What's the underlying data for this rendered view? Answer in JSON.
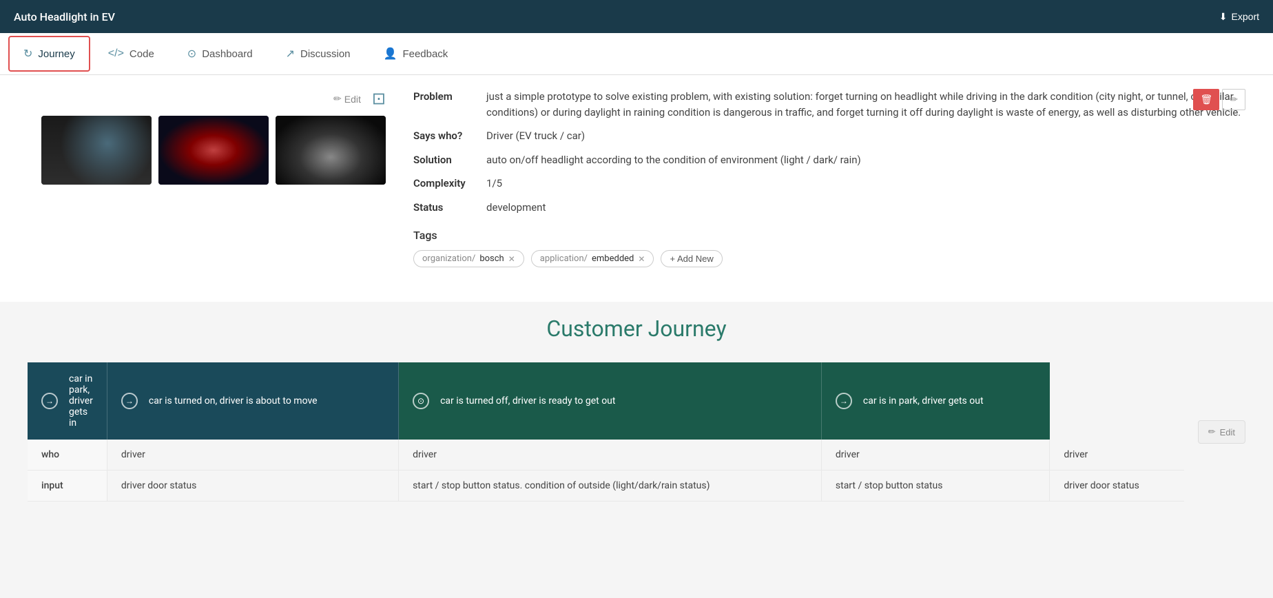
{
  "app": {
    "title": "Auto Headlight in EV",
    "export_label": "Export"
  },
  "nav": {
    "tabs": [
      {
        "id": "journey",
        "label": "Journey",
        "icon": "↻",
        "active": true
      },
      {
        "id": "code",
        "label": "Code",
        "icon": "</>",
        "active": false
      },
      {
        "id": "dashboard",
        "label": "Dashboard",
        "icon": "⊙",
        "active": false
      },
      {
        "id": "discussion",
        "label": "Discussion",
        "icon": "↗",
        "active": false
      },
      {
        "id": "feedback",
        "label": "Feedback",
        "icon": "👤",
        "active": false
      }
    ]
  },
  "details": {
    "edit_label": "Edit",
    "problem_label": "Problem",
    "problem_value": "just a simple prototype to solve existing problem, with existing solution: forget turning on headlight while driving in the dark condition (city night, or tunnel, or similar conditions) or during daylight in raining condition is dangerous in traffic, and forget turning it off during daylight is waste of energy, as well as disturbing other vehicle.",
    "says_who_label": "Says who?",
    "says_who_value": "Driver (EV truck / car)",
    "solution_label": "Solution",
    "solution_value": "auto on/off headlight according to the condition of environment (light / dark/ rain)",
    "complexity_label": "Complexity",
    "complexity_value": "1/5",
    "status_label": "Status",
    "status_value": "development",
    "tags_label": "Tags",
    "tags": [
      {
        "category": "organization",
        "name": "bosch"
      },
      {
        "category": "application",
        "name": "embedded"
      }
    ],
    "add_tag_label": "+ Add New"
  },
  "journey": {
    "section_title": "Customer Journey",
    "edit_label": "✏ Edit",
    "steps": [
      {
        "label": "car in park, driver gets in",
        "icon": "→"
      },
      {
        "label": "car is turned on, driver is about to move",
        "icon": "→"
      },
      {
        "label": "car is turned off, driver is ready to get out",
        "icon": "⊙",
        "darker": true
      },
      {
        "label": "car is in park, driver gets out",
        "icon": "→",
        "darker": true
      }
    ],
    "rows": [
      {
        "row_label": "who",
        "cells": [
          "driver",
          "driver",
          "driver",
          "driver"
        ]
      },
      {
        "row_label": "input",
        "cells": [
          "driver door status",
          "start / stop button status. condition of outside (light/dark/rain status)",
          "start / stop button status",
          "driver door status"
        ]
      }
    ]
  }
}
